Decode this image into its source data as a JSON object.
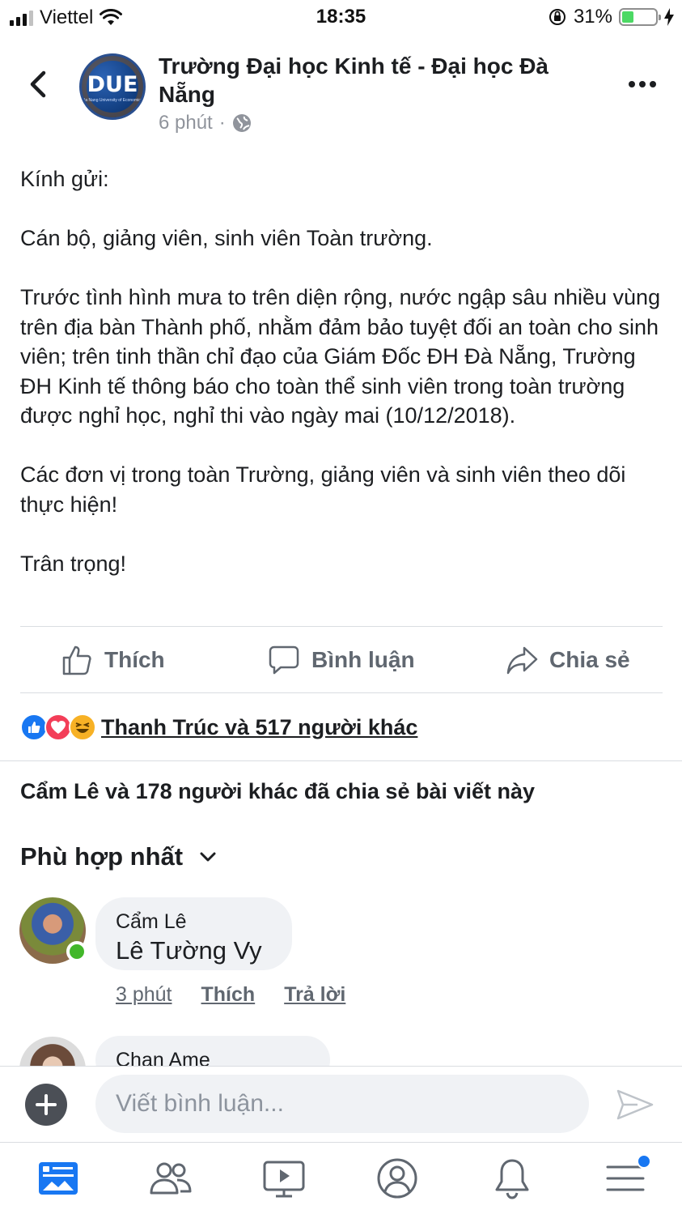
{
  "status_bar": {
    "carrier": "Viettel",
    "time": "18:35",
    "battery": "31%",
    "battery_level": 0.31
  },
  "post": {
    "page_name": "Trường Đại học Kinh tế - Đại học Đà Nẵng",
    "avatar_text": "DUE",
    "avatar_subtext": "Da Nang University of Economics",
    "time": "6 phút",
    "separator": "·",
    "privacy_icon": "globe-icon",
    "body": {
      "greeting": "Kính gửi:",
      "recipients": "Cán bộ, giảng viên, sinh viên Toàn trường.",
      "paragraph1": "Trước tình hình mưa to trên diện rộng, nước ngập sâu nhiều vùng trên địa bàn Thành phố, nhằm đảm bảo tuyệt đối an toàn cho sinh viên; trên tinh thần chỉ đạo của Giám Đốc ĐH Đà Nẵng, Trường ĐH Kinh tế thông báo cho toàn thể sinh viên trong toàn trường được nghỉ học, nghỉ thi vào ngày mai (10/12/2018).",
      "paragraph2": "Các đơn vị trong toàn Trường, giảng viên và sinh viên theo dõi thực hiện!",
      "closing": "Trân trọng!"
    }
  },
  "actions": {
    "like": "Thích",
    "comment": "Bình luận",
    "share": "Chia sẻ"
  },
  "reactions": {
    "icons": [
      "like-icon",
      "love-icon",
      "haha-icon"
    ],
    "text": "Thanh Trúc và 517 người khác"
  },
  "shares_text": "Cẩm Lê và 178 người khác đã chia sẻ bài viết này",
  "sort_label": "Phù hợp nhất",
  "comments": [
    {
      "author": "Cẩm Lê",
      "text": "Lê Tường Vy",
      "time": "3 phút",
      "like": "Thích",
      "reply": "Trả lời"
    },
    {
      "author": "Chan Ame"
    }
  ],
  "composer": {
    "placeholder": "Viết bình luận..."
  },
  "tab_bar": {
    "tabs": [
      "news-feed-icon",
      "friends-icon",
      "watch-icon",
      "profile-icon",
      "notifications-icon",
      "menu-icon"
    ]
  },
  "colors": {
    "text": "#1c1e21",
    "secondary": "#606770",
    "accent": "#1877f2",
    "bubble": "#f0f2f5"
  }
}
